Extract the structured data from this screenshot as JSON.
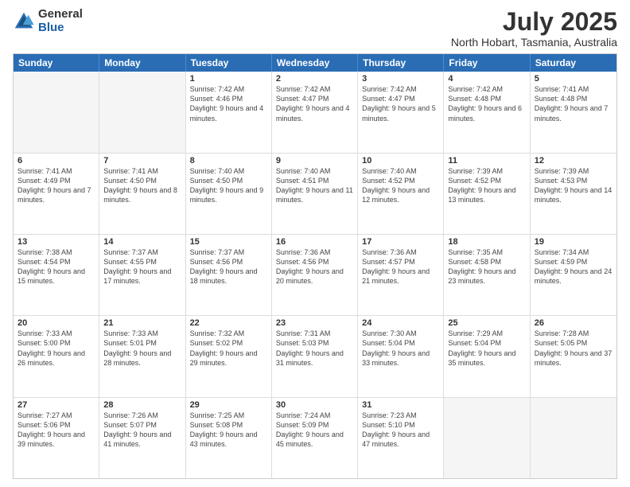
{
  "logo": {
    "general": "General",
    "blue": "Blue"
  },
  "header": {
    "month_year": "July 2025",
    "location": "North Hobart, Tasmania, Australia"
  },
  "weekdays": [
    "Sunday",
    "Monday",
    "Tuesday",
    "Wednesday",
    "Thursday",
    "Friday",
    "Saturday"
  ],
  "rows": [
    [
      {
        "day": "",
        "sunrise": "",
        "sunset": "",
        "daylight": "",
        "empty": true
      },
      {
        "day": "",
        "sunrise": "",
        "sunset": "",
        "daylight": "",
        "empty": true
      },
      {
        "day": "1",
        "sunrise": "Sunrise: 7:42 AM",
        "sunset": "Sunset: 4:46 PM",
        "daylight": "Daylight: 9 hours and 4 minutes."
      },
      {
        "day": "2",
        "sunrise": "Sunrise: 7:42 AM",
        "sunset": "Sunset: 4:47 PM",
        "daylight": "Daylight: 9 hours and 4 minutes."
      },
      {
        "day": "3",
        "sunrise": "Sunrise: 7:42 AM",
        "sunset": "Sunset: 4:47 PM",
        "daylight": "Daylight: 9 hours and 5 minutes."
      },
      {
        "day": "4",
        "sunrise": "Sunrise: 7:42 AM",
        "sunset": "Sunset: 4:48 PM",
        "daylight": "Daylight: 9 hours and 6 minutes."
      },
      {
        "day": "5",
        "sunrise": "Sunrise: 7:41 AM",
        "sunset": "Sunset: 4:48 PM",
        "daylight": "Daylight: 9 hours and 7 minutes."
      }
    ],
    [
      {
        "day": "6",
        "sunrise": "Sunrise: 7:41 AM",
        "sunset": "Sunset: 4:49 PM",
        "daylight": "Daylight: 9 hours and 7 minutes."
      },
      {
        "day": "7",
        "sunrise": "Sunrise: 7:41 AM",
        "sunset": "Sunset: 4:50 PM",
        "daylight": "Daylight: 9 hours and 8 minutes."
      },
      {
        "day": "8",
        "sunrise": "Sunrise: 7:40 AM",
        "sunset": "Sunset: 4:50 PM",
        "daylight": "Daylight: 9 hours and 9 minutes."
      },
      {
        "day": "9",
        "sunrise": "Sunrise: 7:40 AM",
        "sunset": "Sunset: 4:51 PM",
        "daylight": "Daylight: 9 hours and 11 minutes."
      },
      {
        "day": "10",
        "sunrise": "Sunrise: 7:40 AM",
        "sunset": "Sunset: 4:52 PM",
        "daylight": "Daylight: 9 hours and 12 minutes."
      },
      {
        "day": "11",
        "sunrise": "Sunrise: 7:39 AM",
        "sunset": "Sunset: 4:52 PM",
        "daylight": "Daylight: 9 hours and 13 minutes."
      },
      {
        "day": "12",
        "sunrise": "Sunrise: 7:39 AM",
        "sunset": "Sunset: 4:53 PM",
        "daylight": "Daylight: 9 hours and 14 minutes."
      }
    ],
    [
      {
        "day": "13",
        "sunrise": "Sunrise: 7:38 AM",
        "sunset": "Sunset: 4:54 PM",
        "daylight": "Daylight: 9 hours and 15 minutes."
      },
      {
        "day": "14",
        "sunrise": "Sunrise: 7:37 AM",
        "sunset": "Sunset: 4:55 PM",
        "daylight": "Daylight: 9 hours and 17 minutes."
      },
      {
        "day": "15",
        "sunrise": "Sunrise: 7:37 AM",
        "sunset": "Sunset: 4:56 PM",
        "daylight": "Daylight: 9 hours and 18 minutes."
      },
      {
        "day": "16",
        "sunrise": "Sunrise: 7:36 AM",
        "sunset": "Sunset: 4:56 PM",
        "daylight": "Daylight: 9 hours and 20 minutes."
      },
      {
        "day": "17",
        "sunrise": "Sunrise: 7:36 AM",
        "sunset": "Sunset: 4:57 PM",
        "daylight": "Daylight: 9 hours and 21 minutes."
      },
      {
        "day": "18",
        "sunrise": "Sunrise: 7:35 AM",
        "sunset": "Sunset: 4:58 PM",
        "daylight": "Daylight: 9 hours and 23 minutes."
      },
      {
        "day": "19",
        "sunrise": "Sunrise: 7:34 AM",
        "sunset": "Sunset: 4:59 PM",
        "daylight": "Daylight: 9 hours and 24 minutes."
      }
    ],
    [
      {
        "day": "20",
        "sunrise": "Sunrise: 7:33 AM",
        "sunset": "Sunset: 5:00 PM",
        "daylight": "Daylight: 9 hours and 26 minutes."
      },
      {
        "day": "21",
        "sunrise": "Sunrise: 7:33 AM",
        "sunset": "Sunset: 5:01 PM",
        "daylight": "Daylight: 9 hours and 28 minutes."
      },
      {
        "day": "22",
        "sunrise": "Sunrise: 7:32 AM",
        "sunset": "Sunset: 5:02 PM",
        "daylight": "Daylight: 9 hours and 29 minutes."
      },
      {
        "day": "23",
        "sunrise": "Sunrise: 7:31 AM",
        "sunset": "Sunset: 5:03 PM",
        "daylight": "Daylight: 9 hours and 31 minutes."
      },
      {
        "day": "24",
        "sunrise": "Sunrise: 7:30 AM",
        "sunset": "Sunset: 5:04 PM",
        "daylight": "Daylight: 9 hours and 33 minutes."
      },
      {
        "day": "25",
        "sunrise": "Sunrise: 7:29 AM",
        "sunset": "Sunset: 5:04 PM",
        "daylight": "Daylight: 9 hours and 35 minutes."
      },
      {
        "day": "26",
        "sunrise": "Sunrise: 7:28 AM",
        "sunset": "Sunset: 5:05 PM",
        "daylight": "Daylight: 9 hours and 37 minutes."
      }
    ],
    [
      {
        "day": "27",
        "sunrise": "Sunrise: 7:27 AM",
        "sunset": "Sunset: 5:06 PM",
        "daylight": "Daylight: 9 hours and 39 minutes."
      },
      {
        "day": "28",
        "sunrise": "Sunrise: 7:26 AM",
        "sunset": "Sunset: 5:07 PM",
        "daylight": "Daylight: 9 hours and 41 minutes."
      },
      {
        "day": "29",
        "sunrise": "Sunrise: 7:25 AM",
        "sunset": "Sunset: 5:08 PM",
        "daylight": "Daylight: 9 hours and 43 minutes."
      },
      {
        "day": "30",
        "sunrise": "Sunrise: 7:24 AM",
        "sunset": "Sunset: 5:09 PM",
        "daylight": "Daylight: 9 hours and 45 minutes."
      },
      {
        "day": "31",
        "sunrise": "Sunrise: 7:23 AM",
        "sunset": "Sunset: 5:10 PM",
        "daylight": "Daylight: 9 hours and 47 minutes."
      },
      {
        "day": "",
        "sunrise": "",
        "sunset": "",
        "daylight": "",
        "empty": true
      },
      {
        "day": "",
        "sunrise": "",
        "sunset": "",
        "daylight": "",
        "empty": true
      }
    ]
  ]
}
